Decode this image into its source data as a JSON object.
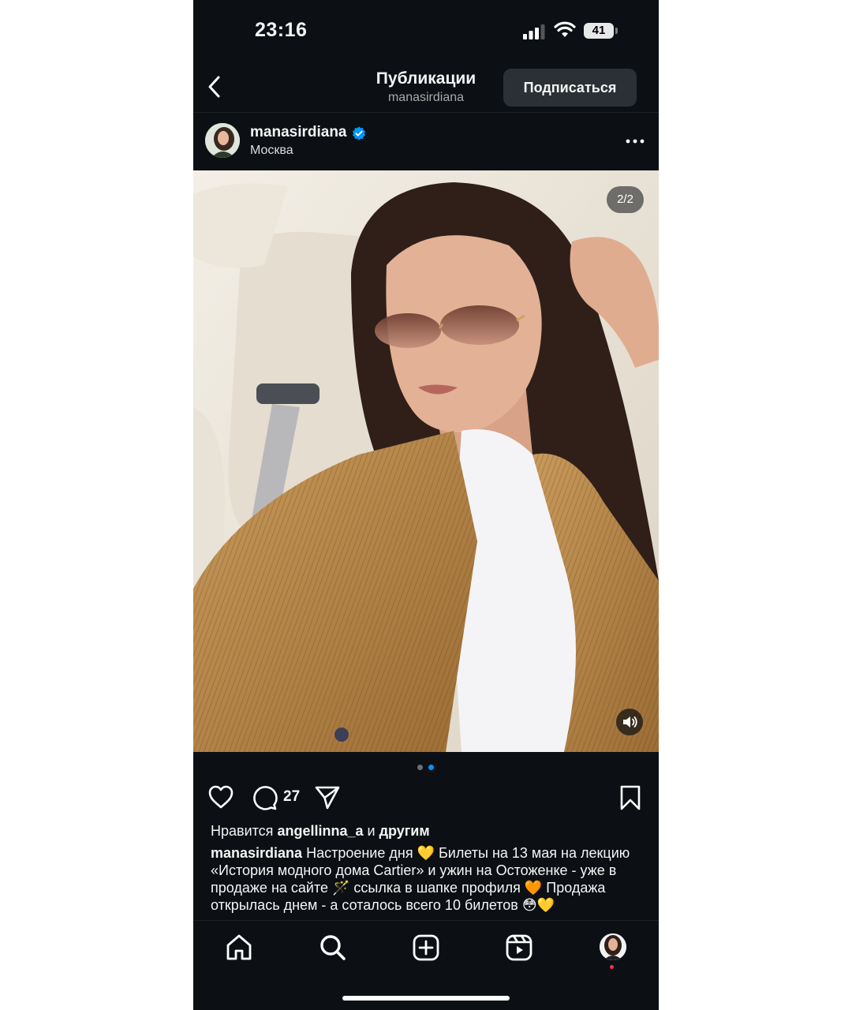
{
  "status_bar": {
    "time": "23:16",
    "battery": "41",
    "icons": [
      "cellular-signal-icon",
      "wifi-icon",
      "battery-icon"
    ]
  },
  "header": {
    "back_icon": "chevron-left-icon",
    "title": "Публикации",
    "subtitle": "manasirdiana",
    "follow_label": "Подписаться"
  },
  "post": {
    "username": "manasirdiana",
    "verified_icon": "verified-badge-icon",
    "location": "Москва",
    "more_icon": "more-horizontal-icon",
    "page_counter": "2/2",
    "carousel": {
      "count": 2,
      "active": 2
    },
    "audio_icon": "speaker-icon",
    "comment_count": "27",
    "likes": {
      "prefix": "Нравится",
      "user": "angellinna_a",
      "suffix": "и другим"
    },
    "caption": {
      "user": "manasirdiana",
      "text": "Настроение дня 💛 Билеты на 13 мая на лекцию «История модного дома Cartier» и ужин на Остоженке - уже в продаже на сайте 🪄 ссылка в шапке профиля 🧡 Продажа открылась днем - а соталось всего 10 билетов 😳💛"
    }
  },
  "tab_bar": {
    "items": [
      "home-icon",
      "search-icon",
      "create-post-icon",
      "reels-icon",
      "profile-avatar"
    ]
  },
  "colors": {
    "background": "#0c1014",
    "verified": "#0095f6",
    "follow_button": "#2b3036",
    "dot_active": "#0095f6"
  }
}
